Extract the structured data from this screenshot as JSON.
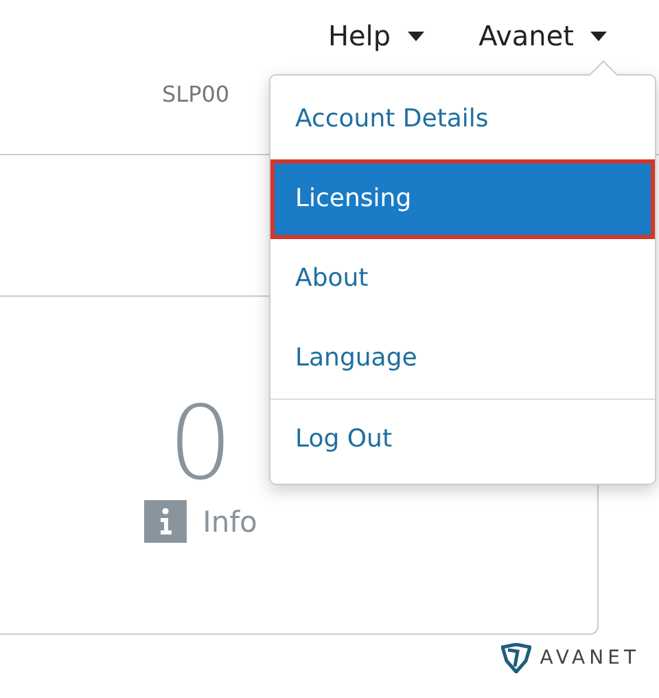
{
  "nav": [
    {
      "label": "Help"
    },
    {
      "label": "Avanet",
      "menu": {
        "sections": [
          [
            {
              "label": "Account Details",
              "selected": false
            },
            {
              "label": "Licensing",
              "selected": true
            },
            {
              "label": "About",
              "selected": false
            },
            {
              "label": "Language",
              "selected": false
            }
          ],
          [
            {
              "label": "Log Out",
              "selected": false
            }
          ]
        ]
      }
    }
  ],
  "subtitle": "SLP00",
  "stat": {
    "value": "0",
    "label": "Info"
  },
  "logo": {
    "text": "AVANET"
  }
}
